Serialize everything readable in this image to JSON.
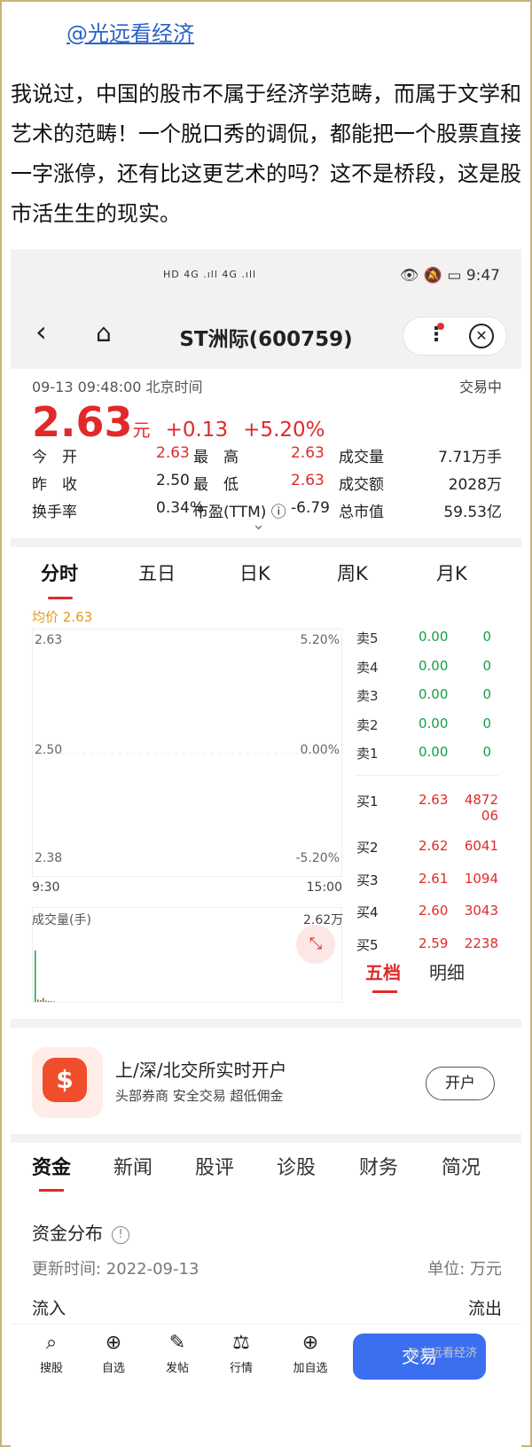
{
  "post": {
    "author": "@光远看经济",
    "text": "我说过，中国的股市不属于经济学范畴，而属于文学和艺术的范畴！一个脱口秀的调侃，都能把一个股票直接一字涨停，还有比这更艺术的吗？这不是桥段，这是股市活生生的现实。"
  },
  "status_bar": {
    "signal": "HD 4G .ıll 4G .ıll",
    "time": "9:47"
  },
  "header": {
    "title": "ST洲际(600759)"
  },
  "meta": {
    "datetime": "09-13 09:48:00 北京时间",
    "state": "交易中"
  },
  "price": {
    "value": "2.63",
    "unit": "元",
    "change": "+0.13",
    "pct": "+5.20%"
  },
  "quote_rows": [
    [
      {
        "l": "今　开"
      },
      {
        "v": "2.63",
        "c": "red"
      },
      {
        "l": "最　高"
      },
      {
        "v": "2.63",
        "c": "red"
      },
      {
        "l": "成交量"
      },
      {
        "v": "7.71万手"
      }
    ],
    [
      {
        "l": "昨　收"
      },
      {
        "v": "2.50"
      },
      {
        "l": "最　低"
      },
      {
        "v": "2.63",
        "c": "red"
      },
      {
        "l": "成交额"
      },
      {
        "v": "2028万"
      }
    ],
    [
      {
        "l": "换手率"
      },
      {
        "v": "0.34%"
      },
      {
        "l": "市盈(TTM) ⓘ"
      },
      {
        "v": "-6.79"
      },
      {
        "l": "总市值"
      },
      {
        "v": "59.53亿"
      }
    ]
  ],
  "chart_tabs": [
    "分时",
    "五日",
    "日K",
    "周K",
    "月K"
  ],
  "avg_label": "均价 2.63",
  "chart_data": {
    "type": "line",
    "price_axis": [
      "2.63",
      "2.50",
      "2.38"
    ],
    "pct_axis": [
      "5.20%",
      "0.00%",
      "-5.20%"
    ],
    "time_axis": [
      "9:30",
      "15:00"
    ],
    "volume_label": "成交量(手)",
    "volume_max": "2.62万",
    "volume_bars": [
      26200,
      1200,
      900,
      2000,
      700,
      500,
      400,
      300
    ]
  },
  "order_book": {
    "sell": [
      {
        "label": "卖5",
        "price": "0.00",
        "vol": "0"
      },
      {
        "label": "卖4",
        "price": "0.00",
        "vol": "0"
      },
      {
        "label": "卖3",
        "price": "0.00",
        "vol": "0"
      },
      {
        "label": "卖2",
        "price": "0.00",
        "vol": "0"
      },
      {
        "label": "卖1",
        "price": "0.00",
        "vol": "0"
      }
    ],
    "buy": [
      {
        "label": "买1",
        "price": "2.63",
        "vol": "4872\n06"
      },
      {
        "label": "买2",
        "price": "2.62",
        "vol": "6041"
      },
      {
        "label": "买3",
        "price": "2.61",
        "vol": "1094"
      },
      {
        "label": "买4",
        "price": "2.60",
        "vol": "3043"
      },
      {
        "label": "买5",
        "price": "2.59",
        "vol": "2238"
      }
    ],
    "tab_on": "五档",
    "tab_off": "明细"
  },
  "promo": {
    "title": "上/深/北交所实时开户",
    "sub": "头部券商  安全交易  超低佣金",
    "button": "开户"
  },
  "section_tabs": [
    "资金",
    "新闻",
    "股评",
    "诊股",
    "财务",
    "简况"
  ],
  "funds": {
    "title": "资金分布",
    "update": "更新时间:   2022-09-13",
    "unit": "单位:   万元",
    "in": "流入",
    "out": "流出"
  },
  "bottom_nav": [
    {
      "icon": "⌕",
      "label": "搜股"
    },
    {
      "icon": "⊕",
      "label": "自选"
    },
    {
      "icon": "✎",
      "label": "发帖"
    },
    {
      "icon": "⚖",
      "label": "行情"
    },
    {
      "icon": "⊕",
      "label": "加自选"
    }
  ],
  "trade_button": "交易",
  "watermark": "@光远看经济",
  "colors": {
    "up": "#e02a2a",
    "down": "#14a04a",
    "accent": "#3b6ff0"
  }
}
